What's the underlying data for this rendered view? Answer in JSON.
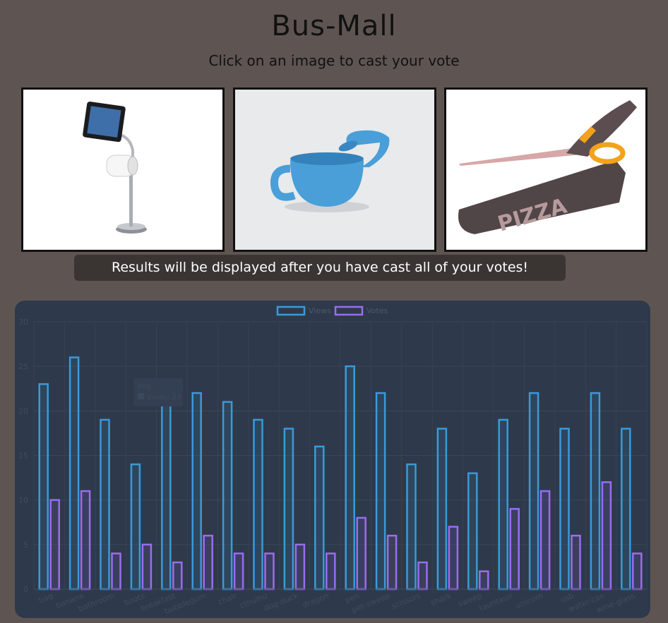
{
  "header": {
    "title": "Bus-Mall",
    "subtitle": "Click on an image to cast your vote"
  },
  "products": [
    {
      "name": "bathroom",
      "icon": "ipad-toilet-paper-stand-image"
    },
    {
      "name": "water-can",
      "icon": "self-watering-can-image"
    },
    {
      "name": "scissors",
      "icon": "pizza-scissors-image"
    }
  ],
  "notice": "Results will be displayed after you have cast all of your votes!",
  "tooltip": {
    "title": "bag",
    "text": "Views: 23"
  },
  "colors": {
    "background": "#5e5552",
    "chart_background": "#2e3a4b",
    "views": "#3a9ad9",
    "votes": "#9b6cf0"
  },
  "chart_data": {
    "type": "bar",
    "categories": [
      "bag",
      "banana",
      "bathroom",
      "boots",
      "breakfast",
      "bubblegum",
      "chair",
      "cthulhu",
      "dog-duck",
      "dragon",
      "pen",
      "pet-sweep",
      "scissors",
      "shark",
      "sweep",
      "tauntaun",
      "unicorn",
      "usb",
      "water-can",
      "wine-glass"
    ],
    "series": [
      {
        "name": "Views",
        "values": [
          23,
          26,
          19,
          14,
          21,
          22,
          21,
          19,
          18,
          16,
          25,
          22,
          14,
          18,
          13,
          19,
          22,
          18,
          22,
          18
        ]
      },
      {
        "name": "Votes",
        "values": [
          10,
          11,
          4,
          5,
          3,
          6,
          4,
          4,
          5,
          4,
          8,
          6,
          3,
          7,
          2,
          9,
          11,
          6,
          12,
          4
        ]
      }
    ],
    "ylim": [
      0,
      30
    ],
    "yticks": [
      0,
      5,
      10,
      15,
      20,
      25,
      30
    ],
    "grid": true,
    "legend": "top"
  }
}
